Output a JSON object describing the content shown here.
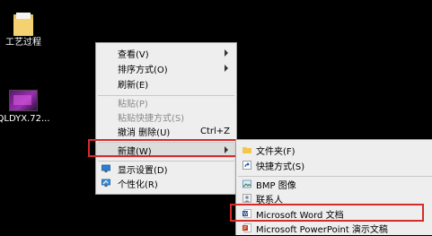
{
  "desktop": {
    "icons": [
      {
        "label": "工艺过程"
      },
      {
        "label": "QLDYX.72..."
      }
    ]
  },
  "context_menu": {
    "items": [
      {
        "label": "查看(V)"
      },
      {
        "label": "排序方式(O)"
      },
      {
        "label": "刷新(E)"
      },
      {
        "label": "粘贴(P)"
      },
      {
        "label": "粘贴快捷方式(S)"
      },
      {
        "label": "撤消 删除(U)",
        "shortcut": "Ctrl+Z"
      },
      {
        "label": "新建(W)"
      },
      {
        "label": "显示设置(D)"
      },
      {
        "label": "个性化(R)"
      }
    ]
  },
  "new_submenu": {
    "items": [
      {
        "label": "文件夹(F)"
      },
      {
        "label": "快捷方式(S)"
      },
      {
        "label": "BMP 图像"
      },
      {
        "label": "联系人"
      },
      {
        "label": "Microsoft Word 文档"
      },
      {
        "label": "Microsoft PowerPoint 演示文稿"
      }
    ]
  },
  "colors": {
    "highlight_box": "#d62b2b",
    "menu_bg": "#eeeeee",
    "folder": "#f5d271"
  }
}
